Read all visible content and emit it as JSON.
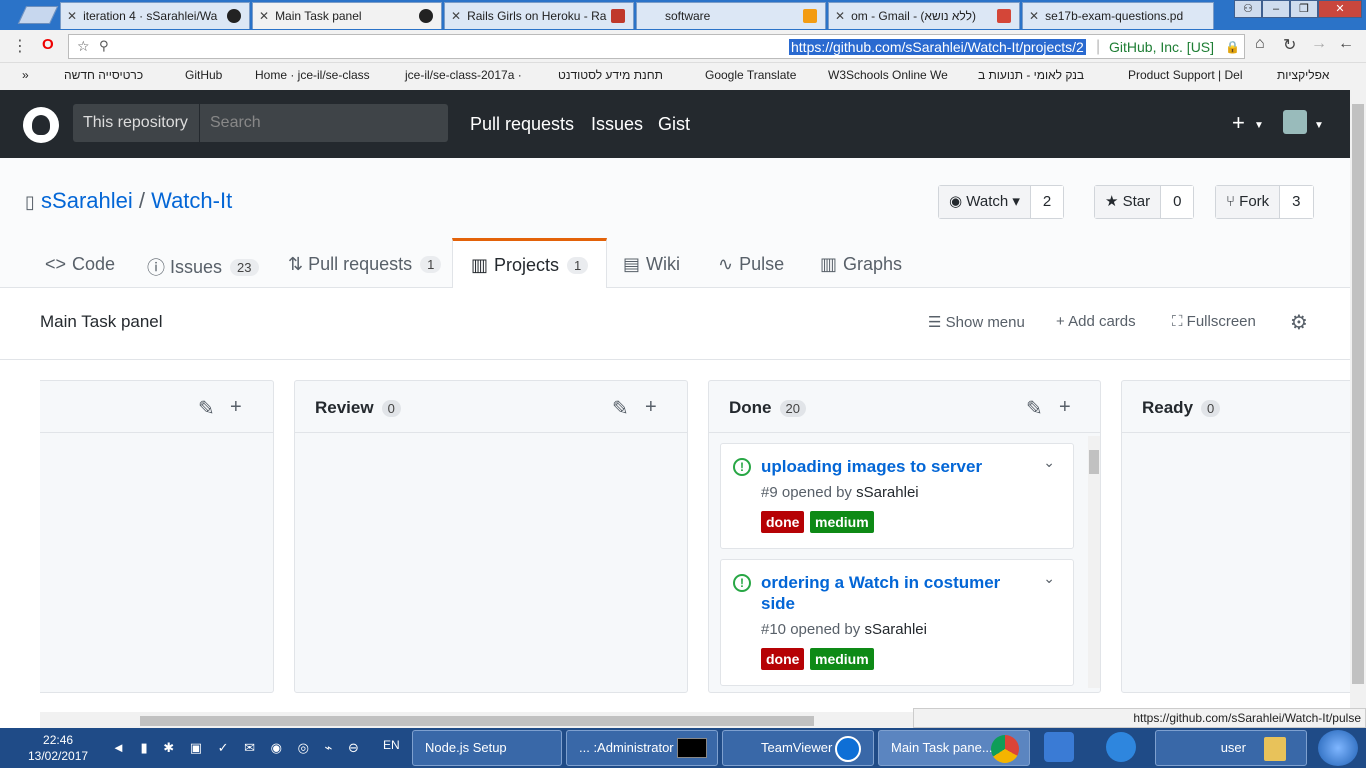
{
  "browser": {
    "tabs": [
      {
        "label": "iteration 4 · sSarahlei/Wa"
      },
      {
        "label": "Main Task panel"
      },
      {
        "label": "Rails Girls on Heroku - Ra"
      },
      {
        "label": "software"
      },
      {
        "label": "om - Gmail - (ללא נושא)"
      },
      {
        "label": "se17b-exam-questions.pd"
      }
    ],
    "url": "https://github.com/sSarahlei/Watch-It/projects/2",
    "site_identity": "GitHub, Inc. [US]",
    "bookmarks": [
      {
        "label": "כרטיסייה חדשה"
      },
      {
        "label": "GitHub"
      },
      {
        "label": "Home · jce-il/se-class"
      },
      {
        "label": "jce-il/se-class-2017a ·"
      },
      {
        "label": "תחנת מידע לסטודנט"
      },
      {
        "label": "Google Translate"
      },
      {
        "label": "W3Schools Online We"
      },
      {
        "label": "בנק לאומי - תנועות ב"
      },
      {
        "label": "Product Support | Del"
      },
      {
        "label": "אפליקציות"
      }
    ],
    "bookmarks_overflow": "»",
    "status_url": "https://github.com/sSarahlei/Watch-It/pulse"
  },
  "github_header": {
    "scope": "This repository",
    "search_placeholder": "Search",
    "nav": [
      "Pull requests",
      "Issues",
      "Gist"
    ]
  },
  "repo": {
    "owner": "sSarahlei",
    "separator": "/",
    "name": "Watch-It",
    "watch": {
      "label": "Watch",
      "count": "2"
    },
    "star": {
      "label": "Star",
      "count": "0"
    },
    "fork": {
      "label": "Fork",
      "count": "3"
    },
    "tabs": [
      {
        "label": "Code",
        "count": null
      },
      {
        "label": "Issues",
        "count": "23"
      },
      {
        "label": "Pull requests",
        "count": "1"
      },
      {
        "label": "Projects",
        "count": "1"
      },
      {
        "label": "Wiki",
        "count": null
      },
      {
        "label": "Pulse",
        "count": null
      },
      {
        "label": "Graphs",
        "count": null
      }
    ]
  },
  "project": {
    "title": "Main Task panel",
    "actions": {
      "show_menu": "Show menu",
      "add_cards": "Add cards",
      "fullscreen": "Fullscreen"
    },
    "columns": [
      {
        "name": "",
        "count": ""
      },
      {
        "name": "Review",
        "count": "0"
      },
      {
        "name": "Done",
        "count": "20"
      },
      {
        "name": "Ready",
        "count": "0"
      }
    ],
    "cards": [
      {
        "title": "uploading images to server",
        "meta_prefix": "#9 opened by",
        "author": "sSarahlei",
        "labels": [
          {
            "text": "done",
            "color": "#b60205"
          },
          {
            "text": "medium",
            "color": "#0e8a16"
          }
        ]
      },
      {
        "title": "ordering a Watch in costumer side",
        "meta_prefix": "#10 opened by",
        "author": "sSarahlei",
        "labels": [
          {
            "text": "done",
            "color": "#b60205"
          },
          {
            "text": "medium",
            "color": "#0e8a16"
          }
        ]
      }
    ]
  },
  "taskbar": {
    "time": "22:46",
    "date": "13/02/2017",
    "lang": "EN",
    "items": [
      {
        "label": "Node.js Setup"
      },
      {
        "label": "... :Administrator"
      },
      {
        "label": "TeamViewer"
      },
      {
        "label": "Main Task pane..."
      },
      {
        "label": "user"
      }
    ]
  }
}
